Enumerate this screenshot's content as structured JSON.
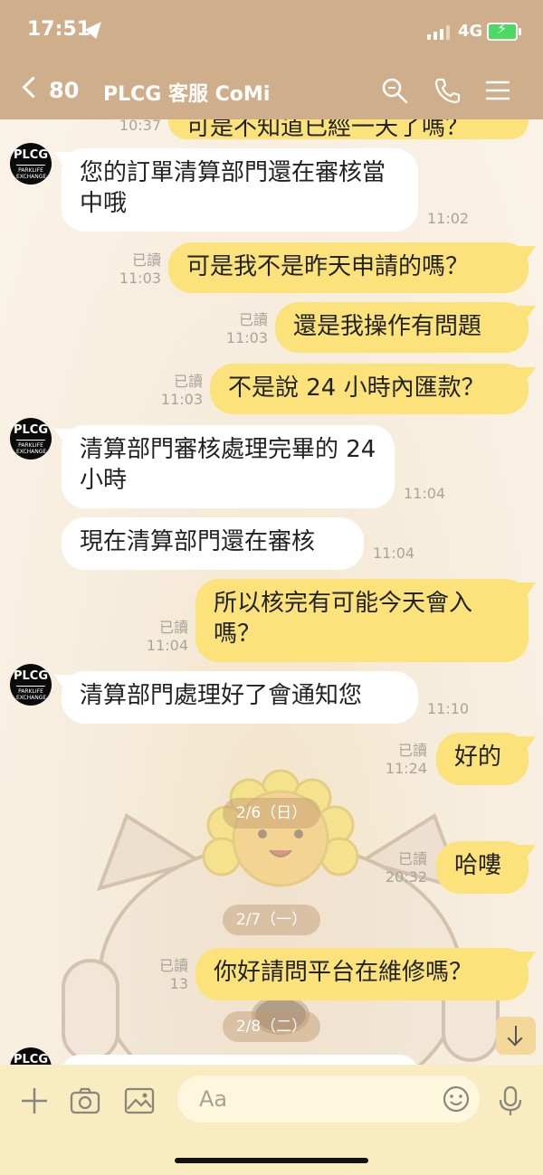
{
  "status": {
    "time": "17:51",
    "network": "4G"
  },
  "header": {
    "back_count": "80",
    "title": "PLCG 客服 CoMi"
  },
  "avatar": {
    "line1": "PLCG",
    "line2": "PARKLIFE",
    "line3": "EXCHANGE"
  },
  "messages": [
    {
      "id": "m0",
      "side": "out",
      "text": "可是不知道已經一天了嗎？",
      "time": "10:37",
      "read": ""
    },
    {
      "id": "m1",
      "side": "in",
      "text": "您的訂單清算部門還在審核當中哦",
      "time": "11:02"
    },
    {
      "id": "m2",
      "side": "out",
      "text": "可是我不是昨天申請的嗎？",
      "read": "已讀",
      "time": "11:03"
    },
    {
      "id": "m3",
      "side": "out",
      "text": "還是我操作有問題",
      "read": "已讀",
      "time": "11:03"
    },
    {
      "id": "m4",
      "side": "out",
      "text": "不是說 24 小時內匯款？",
      "read": "已讀",
      "time": "11:03"
    },
    {
      "id": "m5",
      "side": "in",
      "text": "清算部門審核處理完畢的 24 小時",
      "time": "11:04"
    },
    {
      "id": "m6",
      "side": "in",
      "text": "現在清算部門還在審核",
      "time": "11:04"
    },
    {
      "id": "m7",
      "side": "out",
      "text": "所以核完有可能今天會入嗎？",
      "read": "已讀",
      "time": "11:04"
    },
    {
      "id": "m8",
      "side": "in",
      "text": "清算部門處理好了會通知您",
      "time": "11:10"
    },
    {
      "id": "m9",
      "side": "out",
      "text": "好的",
      "read": "已讀",
      "time": "11:24"
    },
    {
      "id": "m10",
      "side": "out",
      "text": "哈嘍",
      "read": "已讀",
      "time": "20:32"
    },
    {
      "id": "m11",
      "side": "out",
      "text": "你好請問平台在維修嗎？",
      "read": "已讀",
      "time": "13"
    }
  ],
  "dates": [
    "2/6（日）",
    "2/7（一）",
    "2/8（二）"
  ],
  "input": {
    "placeholder": "Aa"
  },
  "icons": {
    "search": "search-icon",
    "phone": "phone-icon",
    "menu": "menu-icon",
    "plus": "plus-icon",
    "camera": "camera-icon",
    "image": "image-icon",
    "emoji": "emoji-icon",
    "mic": "mic-icon",
    "scroll": "arrow-down-icon"
  },
  "colors": {
    "header": "#cfaf8b",
    "outgoing_bubble": "#fbe27a",
    "incoming_bubble": "#ffffff",
    "input_bar": "#f8ecc0"
  }
}
